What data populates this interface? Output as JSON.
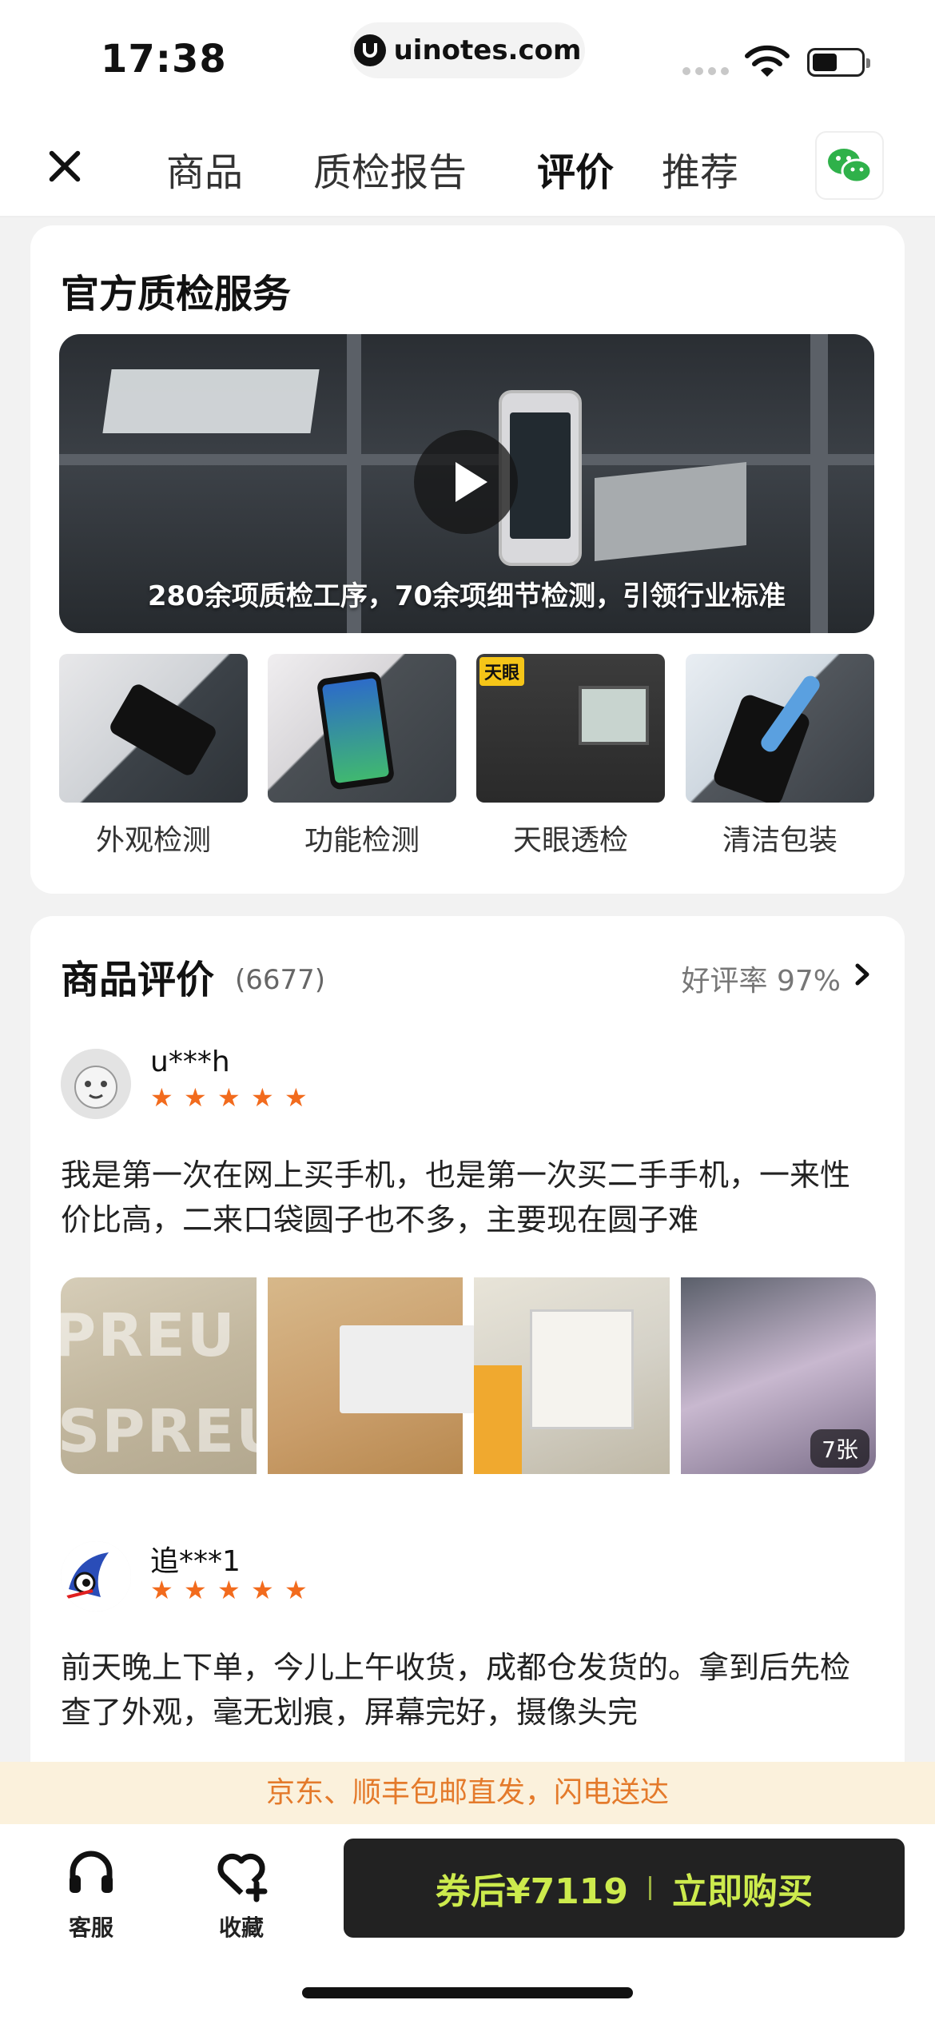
{
  "status_bar": {
    "time": "17:38",
    "url": "uinotes.com"
  },
  "nav": {
    "tabs": [
      {
        "label": "商品",
        "active": false
      },
      {
        "label": "质检报告",
        "active": false
      },
      {
        "label": "评价",
        "active": true
      },
      {
        "label": "推荐",
        "active": false
      }
    ],
    "close_icon": "close-icon",
    "share_icon": "wechat-icon"
  },
  "qc_section": {
    "title": "官方质检服务",
    "video_caption": "280余项质检工序，70余项细节检测，引领行业标准",
    "items": [
      {
        "label": "外观检测"
      },
      {
        "label": "功能检测"
      },
      {
        "label": "天眼透检",
        "badge": "天眼"
      },
      {
        "label": "清洁包装"
      }
    ]
  },
  "reviews_section": {
    "title": "商品评价",
    "count": "(6677)",
    "positive_rate": "好评率 97%",
    "reviews": [
      {
        "user": "u***h",
        "stars": 5,
        "text": "我是第一次在网上买手机，也是第一次买二手手机，一来性价比高，二来口袋圆子也不多，主要现在圆子难",
        "photo_count_badge": "7张"
      },
      {
        "user": "追***1",
        "stars": 5,
        "text": "前天晚上下单，今儿上午收货，成都仓发货的。拿到后先检查了外观，毫无划痕，屏幕完好，摄像头完"
      }
    ]
  },
  "shipping_banner": "京东、顺丰包邮直发，闪电送达",
  "bottom_bar": {
    "service_label": "客服",
    "favorite_label": "收藏",
    "buy_price": "券后¥7119",
    "buy_action": "立即购买"
  },
  "colors": {
    "accent": "#cdeb4d",
    "star": "#f26b1d",
    "banner_text": "#e47a2b"
  }
}
